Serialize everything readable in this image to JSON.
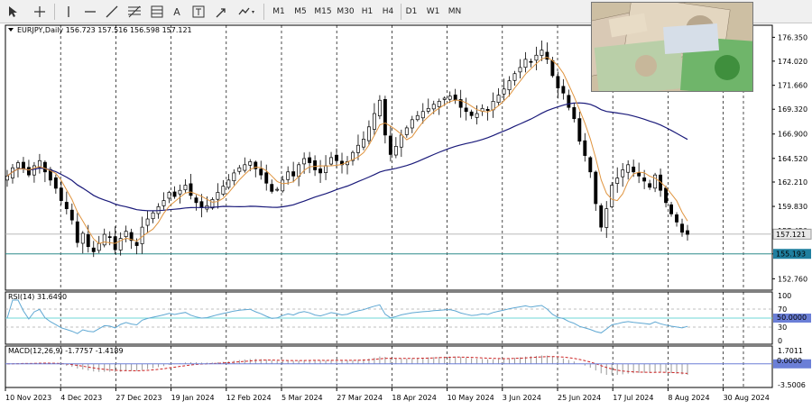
{
  "toolbar": {
    "tools": [
      "cursor-icon",
      "crosshair-icon",
      "vertical-line-icon",
      "horizontal-line-icon",
      "trendline-icon",
      "fibonacci-icon",
      "channel-icon",
      "text-icon",
      "label-icon",
      "shapes-icon"
    ],
    "text_tool": "A",
    "timeframes": [
      "M1",
      "M5",
      "M15",
      "M30",
      "H1",
      "H4",
      "D1",
      "W1",
      "MN"
    ]
  },
  "main_chart": {
    "header": "EURJPY,Daily  156.723 157.516 156.598 157.121",
    "current_price_label": "157.121",
    "hline_label": "155.193",
    "price_ticks": [
      "176.350",
      "174.020",
      "171.660",
      "169.320",
      "166.900",
      "164.520",
      "162.210",
      "159.830",
      "157.450",
      "155.190",
      "152.760"
    ]
  },
  "rsi": {
    "header": "RSI(14) 31.6490",
    "ticks": [
      "100",
      "70",
      "50",
      "30",
      "0"
    ],
    "level_label": "50.0000"
  },
  "macd": {
    "header": "MACD(12,26,9) -1.7757 -1.4189",
    "ticks": [
      "1.7011",
      "-3.5006"
    ],
    "level_label": "0.0000"
  },
  "x_ticks": [
    "10 Nov 2023",
    "4 Dec 2023",
    "27 Dec 2023",
    "19 Jan 2024",
    "12 Feb 2024",
    "5 Mar 2024",
    "27 Mar 2024",
    "18 Apr 2024",
    "10 May 2024",
    "3 Jun 2024",
    "25 Jun 2024",
    "17 Jul 2024",
    "8 Aug 2024",
    "30 Aug 2024"
  ],
  "colors": {
    "candles": "#000000",
    "ma_fast": "#e09540",
    "ma_slow": "#1a1a7a",
    "hline": "#2e8b8b",
    "rsi_line": "#5fa8d3",
    "macd_hist": "#999999",
    "macd_signal": "#cc2222",
    "label_bg_hline": "#1f7f9f",
    "label_bg_level": "#6b7fd7"
  },
  "photo": {
    "label": "currency-banknotes-photo"
  },
  "chart_data": {
    "type": "candlestick",
    "symbol": "EURJPY",
    "timeframe": "Daily",
    "ohlc_last": {
      "open": 156.723,
      "high": 157.516,
      "low": 156.598,
      "close": 157.121
    },
    "ylim": [
      152.0,
      177.0
    ],
    "closes": [
      162.8,
      163.6,
      164.1,
      163.5,
      162.9,
      163.8,
      164.3,
      163.2,
      162.4,
      161.6,
      160.4,
      159.6,
      158.5,
      156.3,
      157.2,
      155.9,
      155.4,
      156.2,
      157.1,
      156.8,
      155.6,
      156.7,
      157.4,
      156.5,
      156.0,
      157.8,
      158.6,
      159.2,
      159.8,
      160.4,
      161.2,
      160.8,
      161.4,
      161.9,
      160.9,
      160.2,
      159.7,
      159.9,
      160.5,
      161.2,
      161.8,
      162.4,
      163.1,
      163.6,
      163.9,
      164.2,
      163.5,
      162.9,
      162.1,
      161.3,
      161.5,
      162.4,
      163.2,
      162.8,
      163.9,
      164.5,
      164.1,
      163.4,
      163.1,
      163.8,
      164.6,
      164.3,
      163.9,
      164.2,
      165.1,
      165.8,
      166.4,
      167.6,
      168.9,
      170.2,
      166.8,
      164.9,
      165.7,
      166.8,
      167.5,
      168.3,
      168.7,
      169.1,
      169.4,
      169.8,
      170.1,
      170.4,
      170.6,
      170.2,
      169.5,
      169.1,
      168.7,
      168.9,
      169.4,
      169.2,
      170.1,
      170.7,
      171.3,
      172.1,
      172.8,
      173.4,
      174.2,
      173.9,
      174.6,
      175.1,
      174.2,
      172.6,
      171.4,
      170.9,
      169.5,
      168.4,
      166.2,
      164.8,
      163.2,
      160.1,
      157.8,
      159.6,
      161.9,
      162.6,
      163.4,
      163.9,
      163.2,
      162.8,
      162.3,
      161.7,
      162.9,
      161.4,
      160.2,
      159.1,
      158.3,
      157.3,
      157.1
    ],
    "ma_fast_color": "#e09540",
    "ma_slow_color": "#1a1a7a",
    "horizontal_line": 155.193,
    "x_tick_labels": [
      "10 Nov 2023",
      "4 Dec 2023",
      "27 Dec 2023",
      "19 Jan 2024",
      "12 Feb 2024",
      "5 Mar 2024",
      "27 Mar 2024",
      "18 Apr 2024",
      "10 May 2024",
      "3 Jun 2024",
      "25 Jun 2024",
      "17 Jul 2024",
      "8 Aug 2024",
      "30 Aug 2024"
    ],
    "rsi": {
      "period": 14,
      "last": 31.649,
      "levels": [
        70,
        50,
        30
      ],
      "ylim": [
        0,
        100
      ]
    },
    "macd": {
      "fast": 12,
      "slow": 26,
      "signal": 9,
      "main": -1.7757,
      "signal_value": -1.4189,
      "ylim": [
        -3.5006,
        1.7011
      ]
    }
  }
}
